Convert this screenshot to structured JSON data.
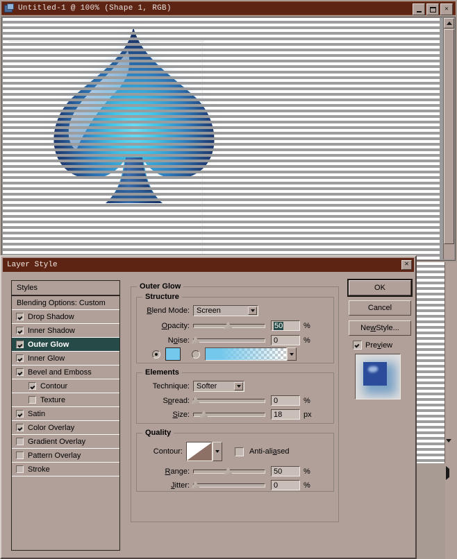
{
  "image_window": {
    "title": "Untitled-1 @ 100% (Shape 1, RGB)",
    "buttons": {
      "minimize": "_",
      "maximize": "□",
      "close": "✕"
    }
  },
  "dialog": {
    "title": "Layer Style",
    "close_label": "✕"
  },
  "styles_panel": {
    "header": "Styles",
    "items": [
      {
        "label": "Blending Options: Custom",
        "has_checkbox": false,
        "checked": false,
        "indent": false,
        "selected": false
      },
      {
        "label": "Drop Shadow",
        "has_checkbox": true,
        "checked": true,
        "indent": false,
        "selected": false
      },
      {
        "label": "Inner Shadow",
        "has_checkbox": true,
        "checked": true,
        "indent": false,
        "selected": false
      },
      {
        "label": "Outer Glow",
        "has_checkbox": true,
        "checked": true,
        "indent": false,
        "selected": true
      },
      {
        "label": "Inner Glow",
        "has_checkbox": true,
        "checked": true,
        "indent": false,
        "selected": false
      },
      {
        "label": "Bevel and Emboss",
        "has_checkbox": true,
        "checked": true,
        "indent": false,
        "selected": false
      },
      {
        "label": "Contour",
        "has_checkbox": true,
        "checked": true,
        "indent": true,
        "selected": false
      },
      {
        "label": "Texture",
        "has_checkbox": true,
        "checked": false,
        "indent": true,
        "selected": false
      },
      {
        "label": "Satin",
        "has_checkbox": true,
        "checked": true,
        "indent": false,
        "selected": false
      },
      {
        "label": "Color Overlay",
        "has_checkbox": true,
        "checked": true,
        "indent": false,
        "selected": false
      },
      {
        "label": "Gradient Overlay",
        "has_checkbox": true,
        "checked": false,
        "indent": false,
        "selected": false
      },
      {
        "label": "Pattern Overlay",
        "has_checkbox": true,
        "checked": false,
        "indent": false,
        "selected": false
      },
      {
        "label": "Stroke",
        "has_checkbox": true,
        "checked": false,
        "indent": false,
        "selected": false
      }
    ]
  },
  "outer_glow": {
    "section_title": "Outer Glow",
    "structure": {
      "legend": "Structure",
      "blend_mode_label": "Blend Mode:",
      "blend_mode_value": "Screen",
      "opacity_label": "Opacity:",
      "opacity_value": "50",
      "opacity_unit": "%",
      "opacity_pct": 50,
      "noise_label": "Noise:",
      "noise_value": "0",
      "noise_unit": "%",
      "noise_pct": 0,
      "fill_mode": "color",
      "color": "#74c8ec",
      "gradient_from": "#74c8ec"
    },
    "elements": {
      "legend": "Elements",
      "technique_label": "Technique:",
      "technique_value": "Softer",
      "spread_label": "Spread:",
      "spread_value": "0",
      "spread_unit": "%",
      "spread_pct": 0,
      "size_label": "Size:",
      "size_value": "18",
      "size_unit": "px",
      "size_pct": 12
    },
    "quality": {
      "legend": "Quality",
      "contour_label": "Contour:",
      "antialiased_label": "Anti-aliased",
      "antialiased_checked": false,
      "range_label": "Range:",
      "range_value": "50",
      "range_unit": "%",
      "range_pct": 50,
      "jitter_label": "Jitter:",
      "jitter_value": "0",
      "jitter_unit": "%",
      "jitter_pct": 0
    }
  },
  "side_buttons": {
    "ok": "OK",
    "cancel": "Cancel",
    "new_style": "New Style...",
    "preview_label": "Preview",
    "preview_checked": true
  },
  "colors": {
    "titlebar": "#5e2413",
    "dialog_face": "#b0a099",
    "selection": "#254a47",
    "glow_color": "#74c8ec",
    "artwork_core": "#3fc3e8",
    "artwork_edge": "#1d3f7a"
  }
}
